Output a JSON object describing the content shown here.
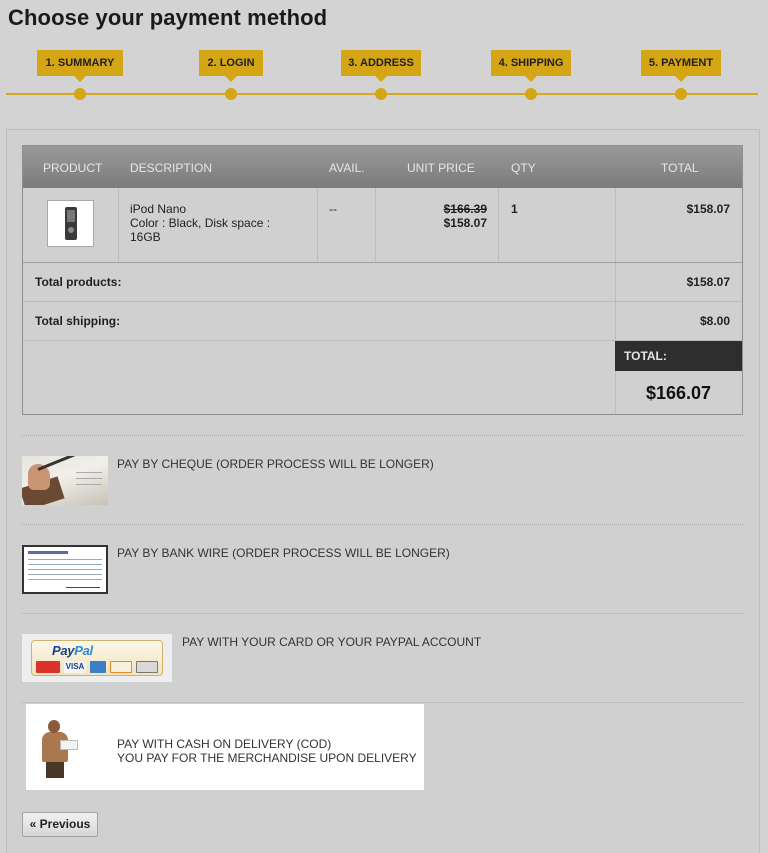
{
  "page": {
    "title": "Choose your payment method"
  },
  "steps": [
    {
      "label": "1. SUMMARY"
    },
    {
      "label": "2. LOGIN"
    },
    {
      "label": "3. ADDRESS"
    },
    {
      "label": "4. SHIPPING"
    },
    {
      "label": "5. PAYMENT"
    }
  ],
  "cart": {
    "headers": {
      "product": "Product",
      "description": "Description",
      "avail": "Avail.",
      "unit_price": "Unit price",
      "qty": "Qty",
      "total": "Total"
    },
    "item": {
      "name": "iPod Nano",
      "attr_line1": "Color : Black, Disk space :",
      "attr_line2": "16GB",
      "avail": "--",
      "old_price": "$166.39",
      "unit_price": "$158.07",
      "qty": "1",
      "total": "$158.07"
    },
    "total_products_label": "Total products:",
    "total_products_value": "$158.07",
    "total_shipping_label": "Total shipping:",
    "total_shipping_value": "$8.00",
    "total_label": "TOTAL:",
    "total_value": "$166.07"
  },
  "payment_options": {
    "cheque": "Pay by cheque (order process will be longer)",
    "bankwire": "Pay by bank wire (order process will be longer)",
    "paypal": "Pay with your card or your PayPal account",
    "cod_line1": "Pay with cash on delivery (COD)",
    "cod_line2": "You pay for the merchandise upon delivery"
  },
  "paypal_logo": {
    "pay": "Pay",
    "pal": "Pal"
  },
  "cards": [
    "MasterCard",
    "VISA",
    "AMEX",
    "DISCOVER",
    "BANQUE"
  ],
  "colors": {
    "accent": "#d4a514",
    "table_header": "#8a8a8a",
    "total_bg": "#2e2e2e"
  },
  "buttons": {
    "previous": "« Previous"
  }
}
